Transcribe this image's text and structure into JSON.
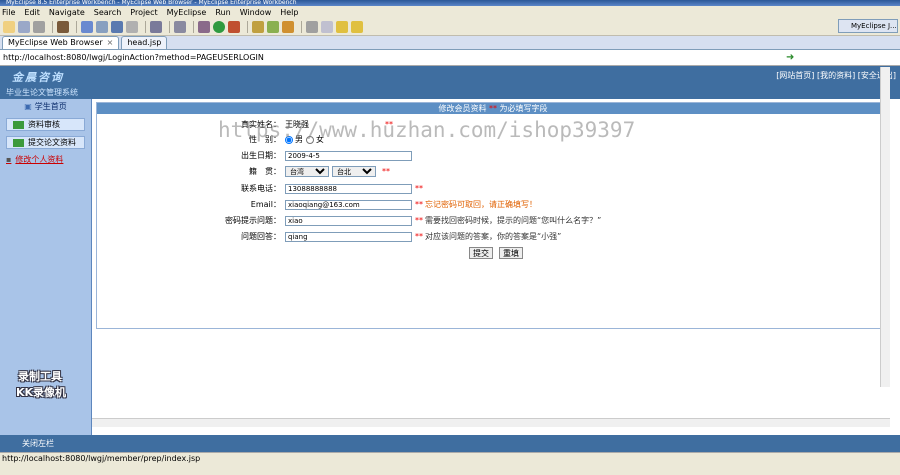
{
  "window": {
    "title": "MyEclipse 8.5 Enterprise Workbench - MyEclipse Web Browser - MyEclipse Enterprise Workbench"
  },
  "menu": [
    "File",
    "Edit",
    "Navigate",
    "Search",
    "Project",
    "MyEclipse",
    "Run",
    "Window",
    "Help"
  ],
  "perspective": {
    "label": "MyEclipse J..."
  },
  "editor_tabs": [
    {
      "label": "MyEclipse Web Browser",
      "close": "×"
    },
    {
      "label": "head.jsp"
    }
  ],
  "address": {
    "url": "http://localhost:8080/lwgj/LoginAction?method=PAGEUSERLOGIN"
  },
  "site": {
    "logo": "金晨咨询",
    "subtitle": "毕业生论文管理系统",
    "header_links": "[网站首页] [我的资料] [安全退出]"
  },
  "sidebar": {
    "head": "学生首页",
    "items": [
      "资料审核",
      "提交论文资料"
    ],
    "link": "修改个人资料"
  },
  "form": {
    "header_title": "修改会员资料",
    "header_required": "**",
    "header_note": "为必填写字段",
    "name": {
      "label": "真实姓名：",
      "value": "王晓强"
    },
    "gender": {
      "label": "性　别：",
      "male": "男",
      "female": "女"
    },
    "birthday": {
      "label": "出生日期：",
      "value": "2009-4-5"
    },
    "native": {
      "label": "籍　贯：",
      "province": "台湾",
      "city": "台北"
    },
    "phone": {
      "label": "联系电话：",
      "value": "13088888888"
    },
    "email": {
      "label": "Email：",
      "value": "xiaoqiang@163.com",
      "hint": "忘记密码可取回，请正确填写！"
    },
    "question": {
      "label": "密码提示问题：",
      "value": "xiao",
      "hint": "需要找回密码时候，提示的问题“您叫什么名字？”"
    },
    "answer": {
      "label": "问题回答：",
      "value": "qiang",
      "hint": "对应该问题的答案，你的答案是“小强”"
    },
    "submit_label": "提交",
    "reset_label": "重填"
  },
  "bottom_bar": {
    "text": "关闭左栏"
  },
  "status": {
    "url": "http://localhost:8080/lwgj/member/prep/index.jsp"
  },
  "overlays": {
    "watermark": "https://www.huzhan.com/ishop39397",
    "rec_label_1": "录制工具",
    "rec_label_2": "KK录像机"
  },
  "colors": {
    "header_blue": "#3f6ea0",
    "sidebar_blue": "#a9c4e8",
    "required_red": "#e00000"
  }
}
